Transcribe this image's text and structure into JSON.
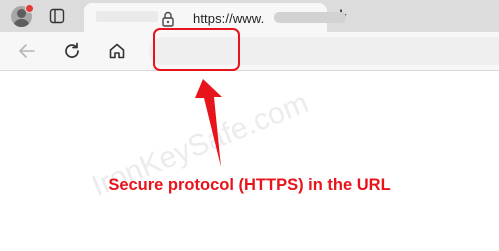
{
  "browser": {
    "tab": {
      "title": "",
      "close_glyph": "✕"
    },
    "new_tab_glyph": "+",
    "address_bar": {
      "scheme_text": "https://www.",
      "host": ""
    },
    "profile_badge_color": "#e53935"
  },
  "annotation": {
    "caption": "Secure protocol (HTTPS) in the URL",
    "watermark": "IronKeySafe.com",
    "highlight_color": "#e8141b"
  }
}
